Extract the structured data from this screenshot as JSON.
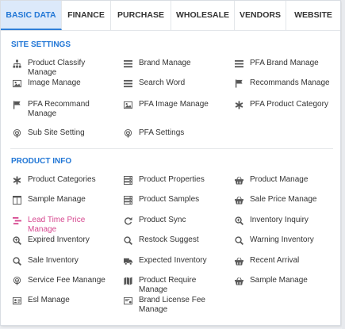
{
  "tabs": [
    "BASIC DATA",
    "FINANCE",
    "PURCHASE",
    "WHOLESALE",
    "VENDORS",
    "WEBSITE"
  ],
  "site_settings": {
    "title": "SITE SETTINGS",
    "items": [
      {
        "label": "Product Classify Manage",
        "icon": "sitemap-icon"
      },
      {
        "label": "Brand Manage",
        "icon": "list-icon"
      },
      {
        "label": "PFA Brand Manage",
        "icon": "list-icon"
      },
      {
        "label": "Image Manage",
        "icon": "image-icon"
      },
      {
        "label": "Search Word",
        "icon": "list-icon"
      },
      {
        "label": "Recommands Manage",
        "icon": "flag-icon"
      },
      {
        "label": "PFA Recommand Manage",
        "icon": "flag-icon"
      },
      {
        "label": "PFA Image Manage",
        "icon": "image-icon"
      },
      {
        "label": "PFA Product Category",
        "icon": "asterisk-icon"
      },
      {
        "label": "Sub Site Setting",
        "icon": "podcast-icon"
      },
      {
        "label": "PFA Settings",
        "icon": "podcast-icon"
      }
    ]
  },
  "product_info": {
    "title": "PRODUCT INFO",
    "items": [
      {
        "label": "Product Categories",
        "icon": "asterisk-icon"
      },
      {
        "label": "Product Properties",
        "icon": "database-icon"
      },
      {
        "label": "Product Manage",
        "icon": "basket-icon"
      },
      {
        "label": "Sample Manage",
        "icon": "columns-icon"
      },
      {
        "label": "Product Samples",
        "icon": "database-icon"
      },
      {
        "label": "Sale Price Manage",
        "icon": "basket-icon"
      },
      {
        "label": "Lead Time Price Manage",
        "icon": "timeline-icon"
      },
      {
        "label": "Product Sync",
        "icon": "refresh-icon"
      },
      {
        "label": "Inventory Inquiry",
        "icon": "zoom-icon"
      },
      {
        "label": "Expired Inventory",
        "icon": "zoom-icon"
      },
      {
        "label": "Restock Suggest",
        "icon": "search-icon"
      },
      {
        "label": "Warning Inventory",
        "icon": "search-icon"
      },
      {
        "label": "Sale Inventory",
        "icon": "search-icon"
      },
      {
        "label": "Expected Inventory",
        "icon": "truck-icon"
      },
      {
        "label": "Recent Arrival",
        "icon": "basket-icon"
      },
      {
        "label": "Service Fee Manange",
        "icon": "podcast-icon"
      },
      {
        "label": "Product Require Manage",
        "icon": "map-icon"
      },
      {
        "label": "Sample Manage",
        "icon": "basket-icon"
      },
      {
        "label": "Esl Manage",
        "icon": "idcard-icon"
      },
      {
        "label": "Brand License Fee Manage",
        "icon": "license-icon"
      }
    ]
  },
  "colors": {
    "accent": "#2277d6",
    "active_tab_bg": "#dce9fa",
    "highlight": "#d6478f"
  }
}
